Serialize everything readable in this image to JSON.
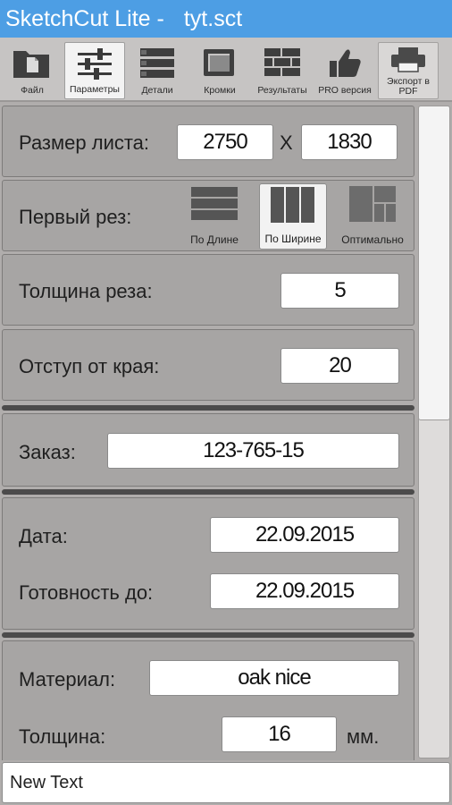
{
  "title": {
    "app": "SketchCut Lite -",
    "file": "tyt.sct"
  },
  "toolbar": {
    "file": "Файл",
    "params": "Параметры",
    "details": "Детали",
    "edges": "Кромки",
    "results": "Результаты",
    "pro": "PRO версия",
    "export": "Экспорт в PDF"
  },
  "sheet": {
    "label": "Размер листа:",
    "width": "2750",
    "x": "X",
    "height": "1830"
  },
  "first_cut": {
    "label": "Первый рез:",
    "options": [
      "По Длине",
      "По Ширине",
      "Оптимально"
    ],
    "selected": "По Ширине"
  },
  "kerf": {
    "label": "Толщина реза:",
    "value": "5"
  },
  "margin": {
    "label": "Отступ от края:",
    "value": "20"
  },
  "order": {
    "label": "Заказ:",
    "value": "123-765-15"
  },
  "date": {
    "label": "Дата:",
    "value": "22.09.2015"
  },
  "ready": {
    "label": "Готовность до:",
    "value": "22.09.2015"
  },
  "material": {
    "label": "Материал:",
    "value": "oak nice"
  },
  "thickness": {
    "label": "Толщина:",
    "value": "16",
    "unit": "мм."
  },
  "bottom_text": "New Text"
}
